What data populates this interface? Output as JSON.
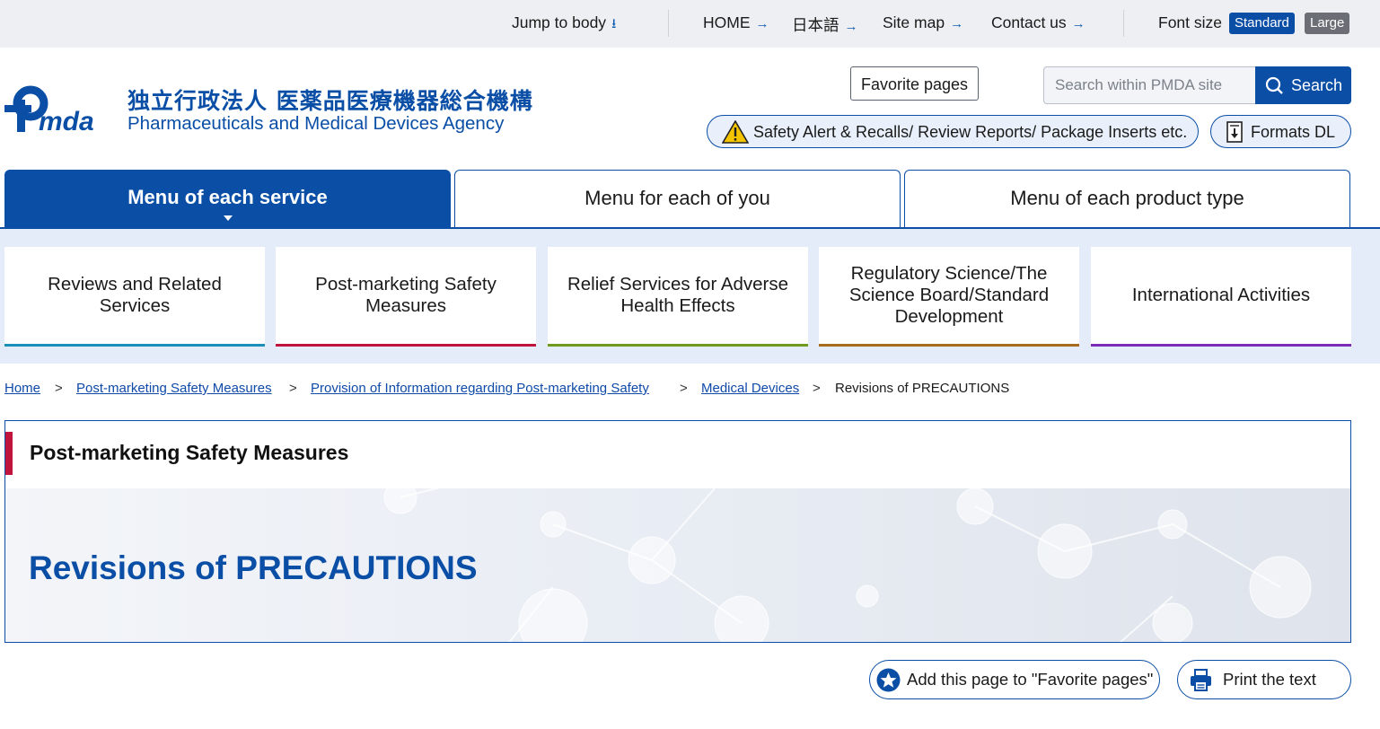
{
  "utility": {
    "jump_to_body": "Jump to body",
    "home": "HOME",
    "japanese": "日本語",
    "site_map": "Site map",
    "contact": "Contact us",
    "font_size_label": "Font size",
    "font_standard": "Standard",
    "font_large": "Large"
  },
  "header": {
    "logo_text": "Pmda",
    "org_name_ja": "独立行政法人 医薬品医療機器総合機構",
    "org_name_en": "Pharmaceuticals and Medical Devices Agency",
    "favorite_pages": "Favorite pages",
    "search_placeholder": "Search within PMDA site",
    "search_label": "Search",
    "safety_alert": "Safety Alert & Recalls/ Review Reports/ Package Inserts etc.",
    "formats_dl": "Formats DL"
  },
  "menu_tabs": [
    {
      "label": "Menu of each service",
      "active": true
    },
    {
      "label": "Menu for each of you",
      "active": false
    },
    {
      "label": "Menu of each product type",
      "active": false
    }
  ],
  "services": [
    {
      "label": "Reviews and Related Services",
      "color": "#1a8fb8"
    },
    {
      "label": "Post-marketing Safety Measures",
      "color": "#c0143c"
    },
    {
      "label": "Relief Services for Adverse Health Effects",
      "color": "#6f9a1f"
    },
    {
      "label": "Regulatory Science/The Science Board/Standard Development",
      "color": "#a86a1c"
    },
    {
      "label": "International Activities",
      "color": "#7a2bb8"
    }
  ],
  "breadcrumb": [
    "Home",
    "Post-marketing Safety Measures",
    "Provision of Information regarding Post-marketing Safety",
    "Medical Devices",
    "Revisions of PRECAUTIONS"
  ],
  "breadcrumb_separator": ">",
  "page": {
    "category": "Post-marketing Safety Measures",
    "title": "Revisions of PRECAUTIONS"
  },
  "actions": {
    "add_favorite": "Add this page to \"Favorite pages\"",
    "print": "Print the text"
  },
  "colors": {
    "brand_blue": "#0a4ea6",
    "category_accent": "#c0143c",
    "font_standard_bg": "#0a4ea6",
    "font_large_bg": "#6b6f75"
  }
}
